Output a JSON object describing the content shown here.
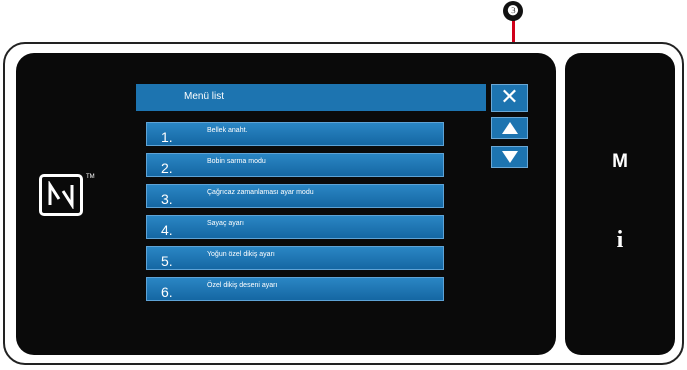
{
  "callout": {
    "number": "❸"
  },
  "screen": {
    "nfc_icon": "nfc-n-icon",
    "nfc_tm": "TM"
  },
  "menu": {
    "title": "Menü list",
    "close_glyph": "✕",
    "items": [
      {
        "num": "1.",
        "label": "Bellek anaht."
      },
      {
        "num": "2.",
        "label": "Bobin sarma modu"
      },
      {
        "num": "3.",
        "label": "Çağrıcaz zamanlaması ayar modu"
      },
      {
        "num": "4.",
        "label": "Sayaç ayarı"
      },
      {
        "num": "5.",
        "label": "Yoğun özel dikiş ayarı"
      },
      {
        "num": "6.",
        "label": "Özel dikiş deseni ayarı"
      }
    ],
    "scroll_up_icon": "triangle-up-icon",
    "scroll_down_icon": "triangle-down-icon"
  },
  "side_panel": {
    "m_key": "M",
    "info_key": "i"
  },
  "colors": {
    "accent": "#1d74b0",
    "callout": "#d0001a",
    "screen_bg": "#0a0a0a"
  }
}
